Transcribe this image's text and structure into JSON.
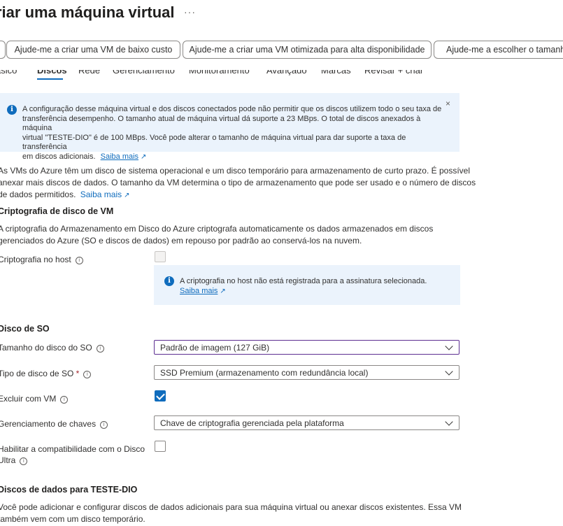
{
  "header": {
    "title": "riar uma máquina virtual",
    "more_label": "···"
  },
  "quick_actions": [
    "Ajude-me a criar uma VM de baixo custo",
    "Ajude-me a criar uma VM otimizada para alta disponibilidade",
    "Ajude-me a escolher o tamanho"
  ],
  "tabs": [
    "ásico",
    "Discos",
    "Rede",
    "Gerenciamento",
    "Monitoramento",
    "Avançado",
    "Marcas",
    "Revisar + criar"
  ],
  "active_tab": "Discos",
  "info_banner": {
    "line1": "A configuração desse máquina virtual e dos discos conectados pode não permitir que os discos utilizem todo o seu taxa de",
    "line2": "transferência desempenho. O tamanho atual de máquina virtual dá suporte a 23 MBps. O total de discos anexados à máquina",
    "line3": "virtual \"TESTE-DIO\" é de 100 MBps. Você pode alterar o tamanho de máquina virtual para dar suporte a taxa de transferência",
    "line4": "em discos adicionais.",
    "link": "Saiba mais",
    "close": "×"
  },
  "intro": {
    "line1": "As VMs do Azure têm um disco de sistema operacional e um disco temporário para armazenamento de curto prazo. É possível",
    "line2": "anexar mais discos de dados. O tamanho da VM determina o tipo de armazenamento que pode ser usado e o número de discos",
    "line3": "de dados permitidos.",
    "link": "Saiba mais"
  },
  "encryption": {
    "heading": "Criptografia de disco de VM",
    "line1": "A criptografia do Armazenamento em Disco do Azure criptografa automaticamente os dados armazenados em discos",
    "line2": "gerenciados do Azure (SO e discos de dados) em repouso por padrão ao conservá-los na nuvem.",
    "host_label": "Criptografia no host",
    "host_info": "A criptografia no host não está registrada para a assinatura selecionada.",
    "host_link": "Saiba mais"
  },
  "os_disk": {
    "heading": "Disco de SO",
    "size_label": "Tamanho do disco do SO",
    "size_value": "Padrão de imagem (127 GiB)",
    "type_label": "Tipo de disco de SO",
    "required_mark": "*",
    "type_value": "SSD Premium (armazenamento com redundância local)",
    "delete_label": "Excluir com VM",
    "key_label": "Gerenciamento de chaves",
    "key_value": "Chave de criptografia gerenciada pela plataforma",
    "ultra_label_1": "Habilitar a compatibilidade com o Disco",
    "ultra_label_2": "Ultra"
  },
  "data_disks": {
    "heading": "Discos de dados para TESTE-DIO",
    "line1": "Você pode adicionar e configurar discos de dados adicionais para sua máquina virtual ou anexar discos existentes. Essa VM",
    "line2": "também vem com um disco temporário."
  },
  "colors": {
    "accent": "#0f6cbd",
    "info_background": "#ebf3fc",
    "focus_border": "#5c2e91"
  }
}
